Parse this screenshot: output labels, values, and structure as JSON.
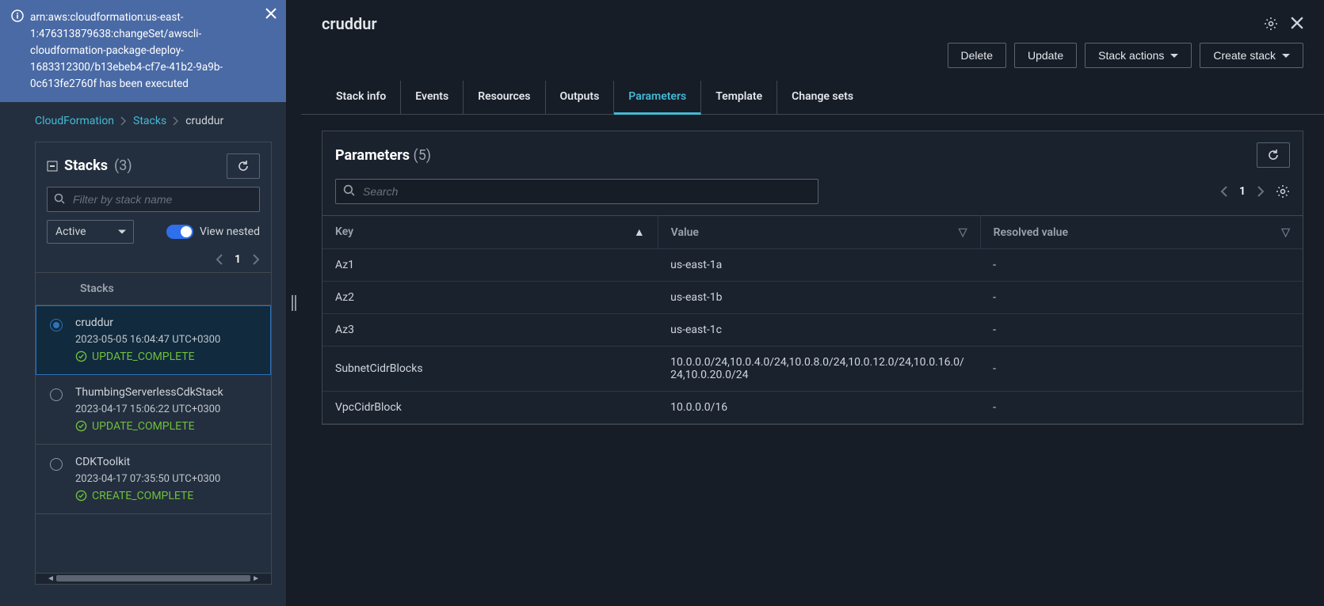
{
  "notice": {
    "text": "arn:aws:cloudformation:us-east-1:476313879638:changeSet/awscli-cloudformation-package-deploy-1683312300/b13ebeb4-cf7e-41b2-9a9b-0c613fe2760f has been executed"
  },
  "breadcrumb": {
    "root": "CloudFormation",
    "mid": "Stacks",
    "current": "cruddur"
  },
  "sidebar": {
    "title": "Stacks",
    "count": "(3)",
    "filter_placeholder": "Filter by stack name",
    "status_filter": "Active",
    "view_nested_label": "View nested",
    "page": "1",
    "list_header": "Stacks",
    "items": [
      {
        "name": "cruddur",
        "timestamp": "2023-05-05 16:04:47 UTC+0300",
        "status": "UPDATE_COMPLETE",
        "selected": true
      },
      {
        "name": "ThumbingServerlessCdkStack",
        "timestamp": "2023-04-17 15:06:22 UTC+0300",
        "status": "UPDATE_COMPLETE",
        "selected": false
      },
      {
        "name": "CDKToolkit",
        "timestamp": "2023-04-17 07:35:50 UTC+0300",
        "status": "CREATE_COMPLETE",
        "selected": false
      }
    ]
  },
  "main": {
    "title": "cruddur",
    "actions": {
      "delete": "Delete",
      "update": "Update",
      "stack_actions": "Stack actions",
      "create_stack": "Create stack"
    },
    "tabs": [
      {
        "label": "Stack info",
        "active": false
      },
      {
        "label": "Events",
        "active": false
      },
      {
        "label": "Resources",
        "active": false
      },
      {
        "label": "Outputs",
        "active": false
      },
      {
        "label": "Parameters",
        "active": true
      },
      {
        "label": "Template",
        "active": false
      },
      {
        "label": "Change sets",
        "active": false
      }
    ],
    "panel": {
      "title": "Parameters",
      "count": "(5)",
      "search_placeholder": "Search",
      "page": "1",
      "columns": {
        "key": "Key",
        "value": "Value",
        "resolved": "Resolved value"
      },
      "rows": [
        {
          "key": "Az1",
          "value": "us-east-1a",
          "resolved": "-"
        },
        {
          "key": "Az2",
          "value": "us-east-1b",
          "resolved": "-"
        },
        {
          "key": "Az3",
          "value": "us-east-1c",
          "resolved": "-"
        },
        {
          "key": "SubnetCidrBlocks",
          "value": "10.0.0.0/24,10.0.4.0/24,10.0.8.0/24,10.0.12.0/24,10.0.16.0/24,10.0.20.0/24",
          "resolved": "-"
        },
        {
          "key": "VpcCidrBlock",
          "value": "10.0.0.0/16",
          "resolved": "-"
        }
      ]
    }
  }
}
